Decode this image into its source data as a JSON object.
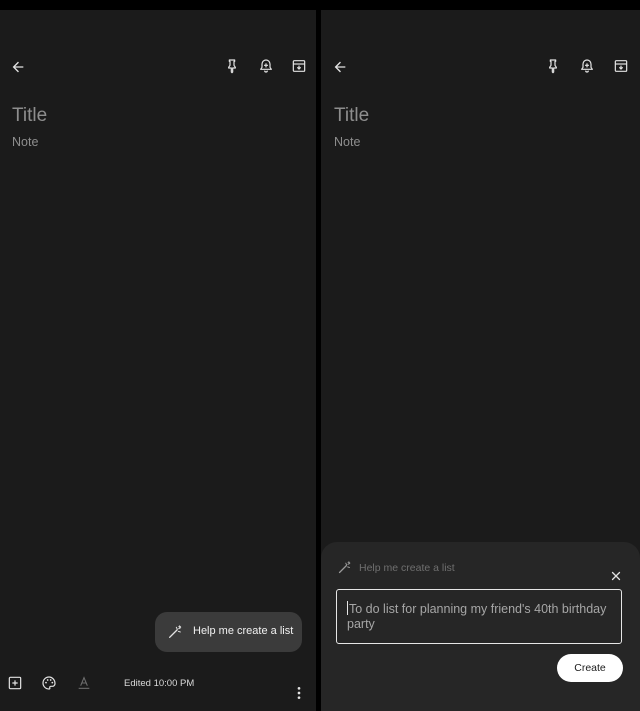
{
  "left_screen": {
    "title_placeholder": "Title",
    "note_placeholder": "Note",
    "assist_chip_label": "Help me create a list",
    "edited_text": "Edited 10:00 PM"
  },
  "right_screen": {
    "title_placeholder": "Title",
    "note_placeholder": "Note",
    "sheet": {
      "header_label": "Help me create a list",
      "prompt_text": "To do list for planning my friend's 40th birthday party",
      "create_label": "Create"
    }
  },
  "icons": {
    "back": "arrow-left-icon",
    "pin": "pin-icon",
    "reminder": "bell-plus-icon",
    "archive": "archive-icon",
    "magic": "magic-wand-icon",
    "add": "add-box-icon",
    "palette": "palette-icon",
    "text_format": "text-format-icon",
    "more": "more-vert-icon",
    "close": "close-icon"
  },
  "colors": {
    "background": "#1b1b1b",
    "chip": "#3b3b3b",
    "sheet": "#262626",
    "text_primary": "#e3e3e3",
    "placeholder": "#8e8e8e"
  }
}
